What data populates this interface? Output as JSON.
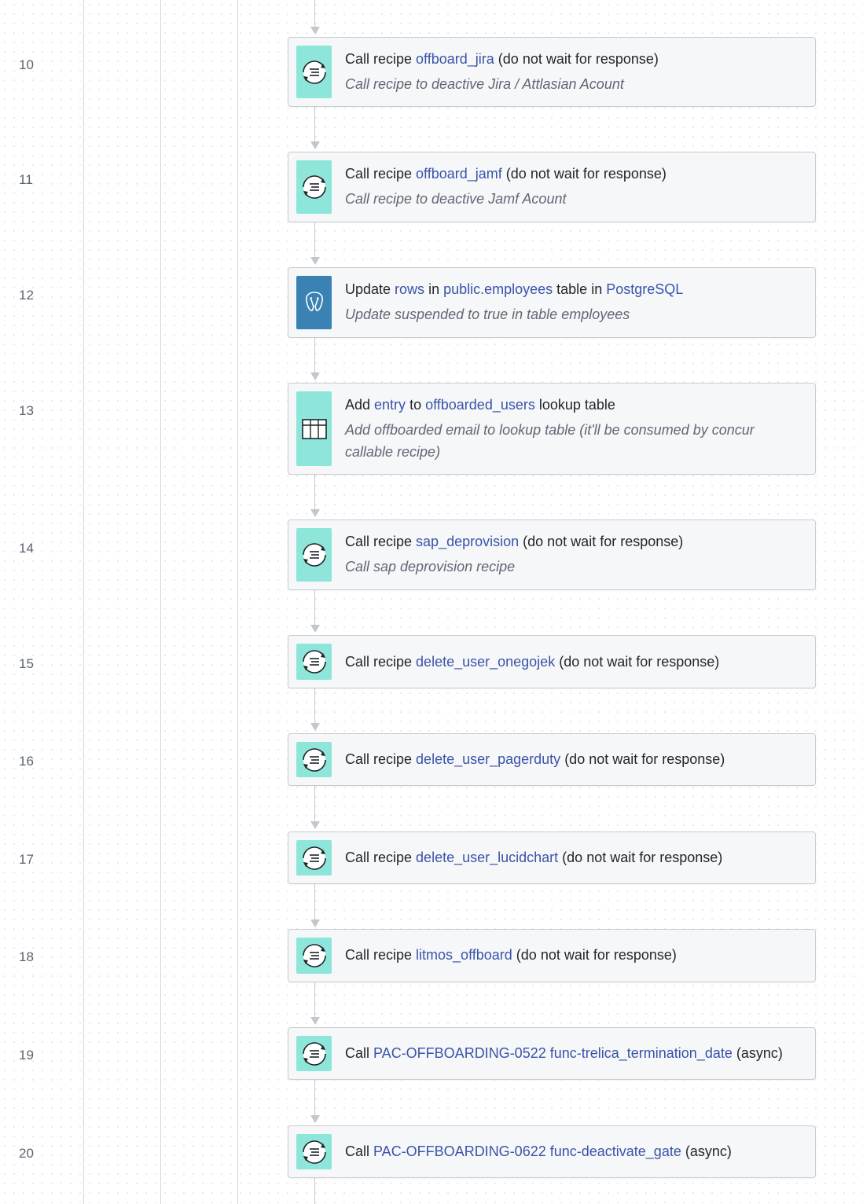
{
  "steps": [
    {
      "num": "10",
      "icon": "call-recipe-icon",
      "title": [
        {
          "t": "Call recipe ",
          "link": false
        },
        {
          "t": "offboard_jira",
          "link": true
        },
        {
          "t": " (do not wait for response)",
          "link": false
        }
      ],
      "description": "Call recipe to deactive Jira / Attlasian Acount"
    },
    {
      "num": "11",
      "icon": "call-recipe-icon",
      "title": [
        {
          "t": "Call recipe ",
          "link": false
        },
        {
          "t": "offboard_jamf",
          "link": true
        },
        {
          "t": " (do not wait for response)",
          "link": false
        }
      ],
      "description": "Call recipe to deactive Jamf Acount"
    },
    {
      "num": "12",
      "icon": "postgresql-icon",
      "title": [
        {
          "t": "Update ",
          "link": false
        },
        {
          "t": "rows",
          "link": true
        },
        {
          "t": " in ",
          "link": false
        },
        {
          "t": "public.employees",
          "link": true
        },
        {
          "t": " table in ",
          "link": false
        },
        {
          "t": "PostgreSQL",
          "link": true
        }
      ],
      "description": "Update suspended to true in table employees"
    },
    {
      "num": "13",
      "icon": "lookup-table-icon",
      "title": [
        {
          "t": "Add ",
          "link": false
        },
        {
          "t": "entry",
          "link": true
        },
        {
          "t": " to ",
          "link": false
        },
        {
          "t": "offboarded_users",
          "link": true
        },
        {
          "t": " lookup table",
          "link": false
        }
      ],
      "description": "Add offboarded email to lookup table (it'll be consumed by concur callable recipe)"
    },
    {
      "num": "14",
      "icon": "call-recipe-icon",
      "title": [
        {
          "t": "Call recipe ",
          "link": false
        },
        {
          "t": "sap_deprovision",
          "link": true
        },
        {
          "t": " (do not wait for response)",
          "link": false
        }
      ],
      "description": "Call sap deprovision recipe"
    },
    {
      "num": "15",
      "icon": "call-recipe-icon",
      "title": [
        {
          "t": "Call recipe ",
          "link": false
        },
        {
          "t": "delete_user_onegojek",
          "link": true
        },
        {
          "t": " (do not wait for response)",
          "link": false
        }
      ],
      "description": ""
    },
    {
      "num": "16",
      "icon": "call-recipe-icon",
      "title": [
        {
          "t": "Call recipe ",
          "link": false
        },
        {
          "t": "delete_user_pagerduty",
          "link": true
        },
        {
          "t": " (do not wait for response)",
          "link": false
        }
      ],
      "description": ""
    },
    {
      "num": "17",
      "icon": "call-recipe-icon",
      "title": [
        {
          "t": "Call recipe ",
          "link": false
        },
        {
          "t": "delete_user_lucidchart",
          "link": true
        },
        {
          "t": " (do not wait for response)",
          "link": false
        }
      ],
      "description": ""
    },
    {
      "num": "18",
      "icon": "call-recipe-icon",
      "title": [
        {
          "t": "Call recipe ",
          "link": false
        },
        {
          "t": "litmos_offboard",
          "link": true
        },
        {
          "t": " (do not wait for response)",
          "link": false
        }
      ],
      "description": ""
    },
    {
      "num": "19",
      "icon": "call-recipe-icon",
      "title": [
        {
          "t": "Call ",
          "link": false
        },
        {
          "t": "PAC-OFFBOARDING-0522 func-trelica_termination_date",
          "link": true
        },
        {
          "t": " (async)",
          "link": false
        }
      ],
      "description": ""
    },
    {
      "num": "20",
      "icon": "call-recipe-icon",
      "title": [
        {
          "t": "Call ",
          "link": false
        },
        {
          "t": "PAC-OFFBOARDING-0622 func-deactivate_gate",
          "link": true
        },
        {
          "t": " (async)",
          "link": false
        }
      ],
      "description": ""
    }
  ]
}
